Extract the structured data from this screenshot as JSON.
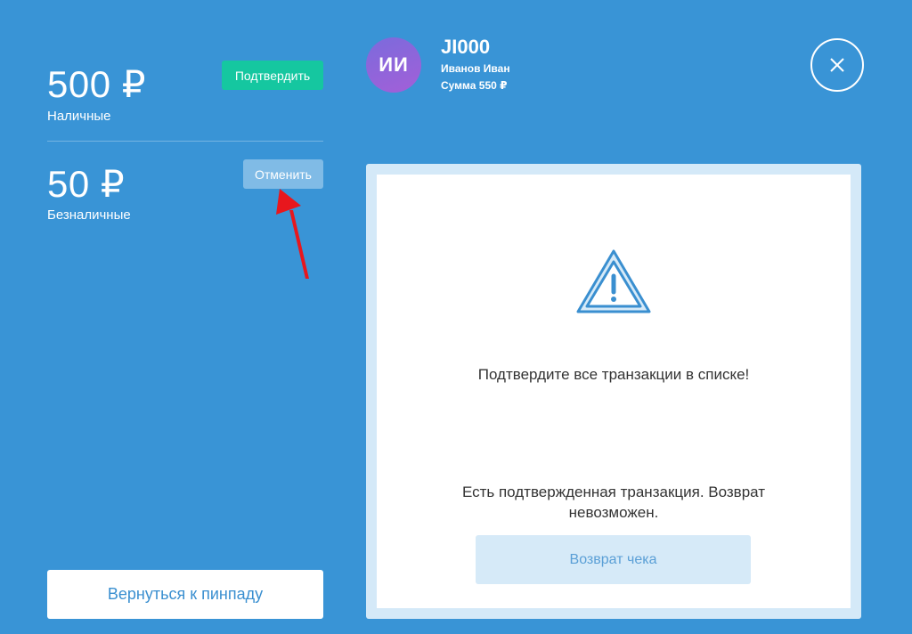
{
  "payments": {
    "cash": {
      "amount": "500 ₽",
      "method": "Наличные",
      "action_label": "Подтвердить"
    },
    "card": {
      "amount": "50 ₽",
      "method": "Безналичные",
      "action_label": "Отменить"
    }
  },
  "back_button": {
    "label": "Вернуться к пинпаду"
  },
  "header": {
    "avatar_initials": "ИИ",
    "order_id": "JI000",
    "customer_name": "Иванов Иван",
    "sum": "Сумма 550 ₽"
  },
  "panel": {
    "warning_message": "Подтвердите все транзакции в списке!",
    "refund_message": "Есть подтвержденная транзакция. Возврат невозможен.",
    "refund_button_label": "Возврат чека"
  },
  "icons": {
    "close": "close-icon",
    "warning": "warning-triangle-icon",
    "annotation": "red-arrow-annotation"
  },
  "colors": {
    "background": "#3994d6",
    "confirm": "#15c7a0",
    "cancel": "#80bbe6",
    "avatar": "#9163da",
    "warning_icon": "#3a8fd0",
    "annotation": "#e8171d"
  }
}
